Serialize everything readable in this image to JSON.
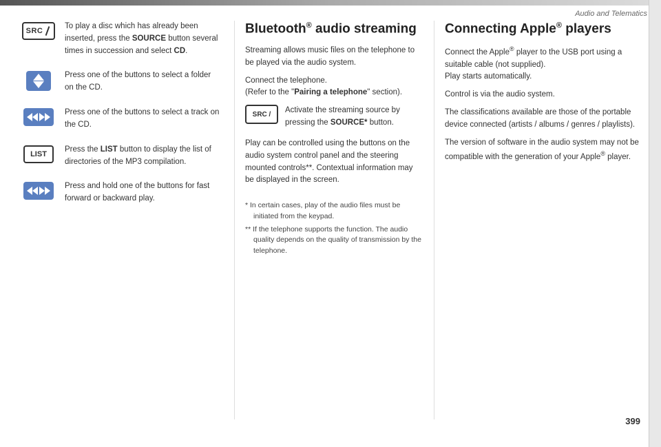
{
  "header": {
    "bar_decoration": true,
    "top_label": "Audio and Telematics"
  },
  "page_number": "399",
  "left_column": {
    "icon_rows": [
      {
        "icon_type": "src",
        "text": "To play a disc which has already been inserted, press the SOURCE button several times in succession and select CD.",
        "bold_words": [
          "SOURCE",
          "CD"
        ]
      },
      {
        "icon_type": "updown",
        "text": "Press one of the buttons to select a folder on the CD.",
        "bold_words": []
      },
      {
        "icon_type": "ff",
        "text": "Press one of the buttons to select a track on the CD.",
        "bold_words": []
      },
      {
        "icon_type": "list",
        "text": "Press the LIST button to display the list of directories of the MP3 compilation.",
        "bold_words": [
          "LIST"
        ]
      },
      {
        "icon_type": "ff",
        "text": "Press and hold one of the buttons for fast forward or backward play.",
        "bold_words": []
      }
    ]
  },
  "middle_column": {
    "title": "Bluetooth® audio streaming",
    "title_superscript": "®",
    "intro_text": "Streaming allows music files on the telephone to be played via the audio system.",
    "connect_text": "Connect the telephone.\n(Refer to the \"Pairing a telephone\" section).",
    "pairing_bold": "Pairing a telephone",
    "src_row": {
      "text": "Activate the streaming source by pressing the SOURCE* button.",
      "source_bold": "SOURCE*"
    },
    "play_text": "Play can be controlled using the buttons on the audio system control panel and the steering mounted controls**. Contextual information may be displayed in the screen.",
    "footnotes": [
      "* In certain cases, play of the audio files must be initiated from the keypad.",
      "** If the telephone supports the function. The audio quality depends on the quality of transmission by the telephone."
    ]
  },
  "right_column": {
    "title": "Connecting Apple® players",
    "title_superscript": "®",
    "para1": "Connect the Apple® player to the USB port using a suitable cable (not supplied).\nPlay starts automatically.",
    "para2": "Control is via the audio system.",
    "para3": "The classifications available are those of the portable device connected (artists / albums / genres / playlists).",
    "para4": "The version of software in the audio system may not be compatible with the generation of your Apple® player.",
    "apple_superscripts": [
      "®",
      "®",
      "®"
    ]
  }
}
